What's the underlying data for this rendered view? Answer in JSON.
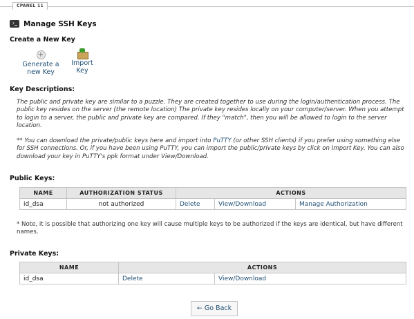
{
  "header": {
    "brand": "CPANEL 11"
  },
  "page": {
    "title": "Manage SSH Keys"
  },
  "create": {
    "heading": "Create a New Key",
    "generate_line1": "Generate a",
    "generate_line2": "new Key",
    "import_line1": "Import",
    "import_line2": "Key"
  },
  "descriptions": {
    "heading": "Key Descriptions:",
    "para1": "The public and private key are similar to a puzzle. They are created together to use during the login/authentication process. The public key resides on the server (the remote location) The private key resides locally on your computer/server. When you attempt to login to a server, the public and private key are compared. If they \"match\", then you will be allowed to login to the server location.",
    "para2_before": "** You can download the private/public keys here and import into ",
    "para2_link": "PuTTY",
    "para2_after": " (or other SSH clients) if you prefer using something else for SSH connections. Or, if you have been using PuTTY, you can import the public/private keys by click on Import Key. You can also download your key in PuTTY's ppk format under View/Download."
  },
  "public_keys": {
    "heading": "Public Keys:",
    "columns": {
      "name": "Name",
      "status": "Authorization Status",
      "actions": "Actions"
    },
    "rows": [
      {
        "name": "id_dsa",
        "status": "not authorized",
        "delete": "Delete",
        "view": "View/Download",
        "manage": "Manage Authorization"
      }
    ],
    "note": "* Note, it is possible that authorizing one key will cause multiple keys to be authorized if the keys are identical, but have different names."
  },
  "private_keys": {
    "heading": "Private Keys:",
    "columns": {
      "name": "Name",
      "actions": "Actions"
    },
    "rows": [
      {
        "name": "id_dsa",
        "delete": "Delete",
        "view": "View/Download"
      }
    ]
  },
  "footer": {
    "back_label": "Go Back",
    "back_arrow": "←"
  }
}
